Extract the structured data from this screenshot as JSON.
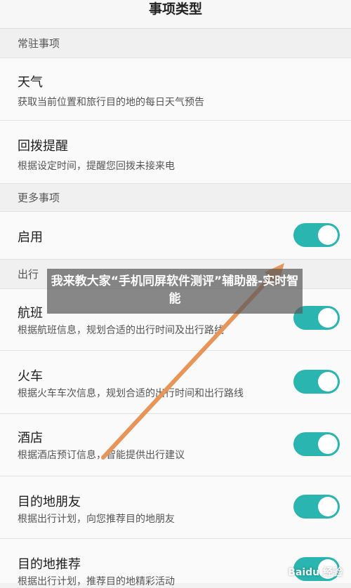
{
  "header": {
    "title": "事项类型"
  },
  "sections": {
    "resident": {
      "label": "常驻事项"
    },
    "more": {
      "label": "更多事项"
    },
    "travel": {
      "label": "出行"
    }
  },
  "items": {
    "weather": {
      "title": "天气",
      "subtitle": "获取当前位置和旅行目的地的每日天气预告"
    },
    "callback": {
      "title": "回拨提醒",
      "subtitle": "根据设定时间，提醒您回拨未接来电"
    },
    "enable": {
      "title": "启用",
      "enabled": true
    },
    "flight": {
      "title": "航班",
      "subtitle": "根据航班信息，规划合适的出行时间及出行路线",
      "enabled": true
    },
    "train": {
      "title": "火车",
      "subtitle": "根据火车车次信息，规划合适的出行时间和出行路线",
      "enabled": true
    },
    "hotel": {
      "title": "酒店",
      "subtitle": "根据酒店预订信息，智能提供出行建议",
      "enabled": true
    },
    "destination_friends": {
      "title": "目的地朋友",
      "subtitle": "根据出行计划，向您推荐目的地朋友",
      "enabled": true
    },
    "destination_recommend": {
      "title": "目的地推荐",
      "subtitle": "根据出行计划，推荐目的地精彩活动",
      "enabled": true
    }
  },
  "overlay": {
    "text": "我来教大家“手机同屏软件测评”辅助器-实时智能"
  },
  "watermark": {
    "text": "Baidu 经验"
  },
  "colors": {
    "toggle_on": "#2ab5b0",
    "arrow": "#e8955a"
  }
}
